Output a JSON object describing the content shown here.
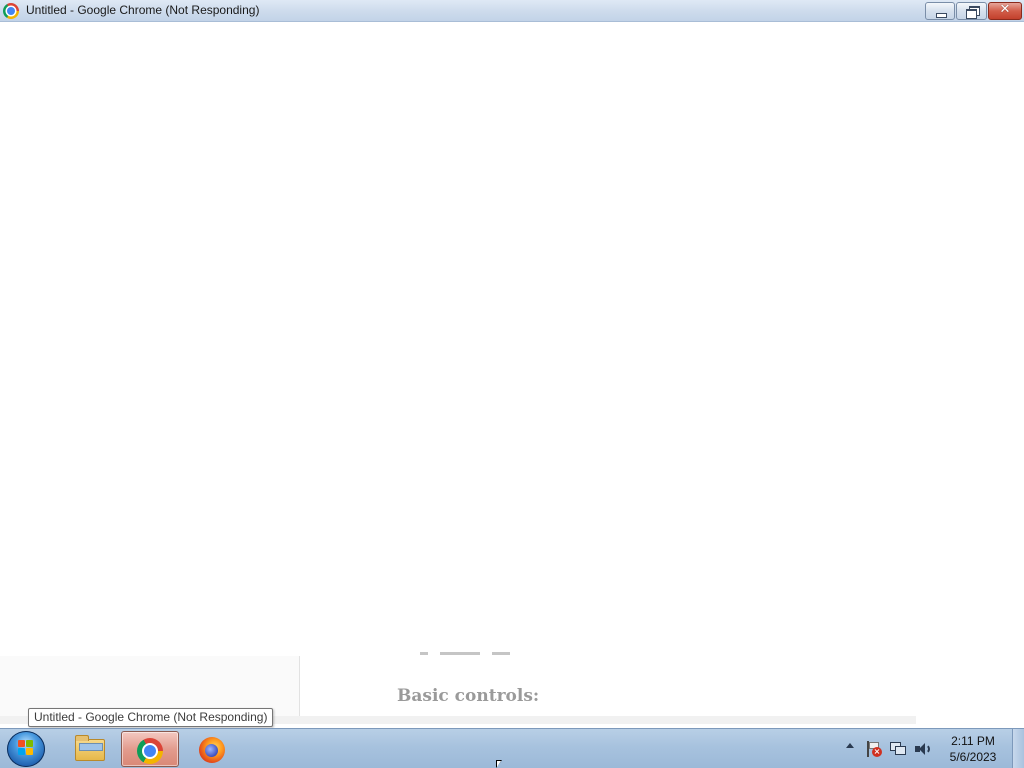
{
  "window": {
    "title": "Untitled - Google Chrome (Not Responding)",
    "controls": {
      "close_glyph": "✕"
    }
  },
  "page": {
    "section_heading": "Basic controls:"
  },
  "tooltip": {
    "text": "Untitled - Google Chrome (Not Responding)"
  },
  "taskbar": {
    "items": [
      {
        "name": "Windows Explorer",
        "icon": "folder-icon"
      },
      {
        "name": "Google Chrome",
        "icon": "chrome-icon",
        "active": true
      },
      {
        "name": "Firefox",
        "icon": "firefox-icon"
      }
    ],
    "tray": {
      "icons": [
        "show-hidden-icons-arrow-icon",
        "action-center-flag-icon",
        "network-icon",
        "volume-icon"
      ],
      "time": "2:11 PM",
      "date": "5/6/2023"
    }
  },
  "colors": {
    "taskbar": "#a7c2de",
    "titlebar": "#cddbec",
    "close_button": "#d25e4a",
    "active_task": "#e39c8e"
  }
}
